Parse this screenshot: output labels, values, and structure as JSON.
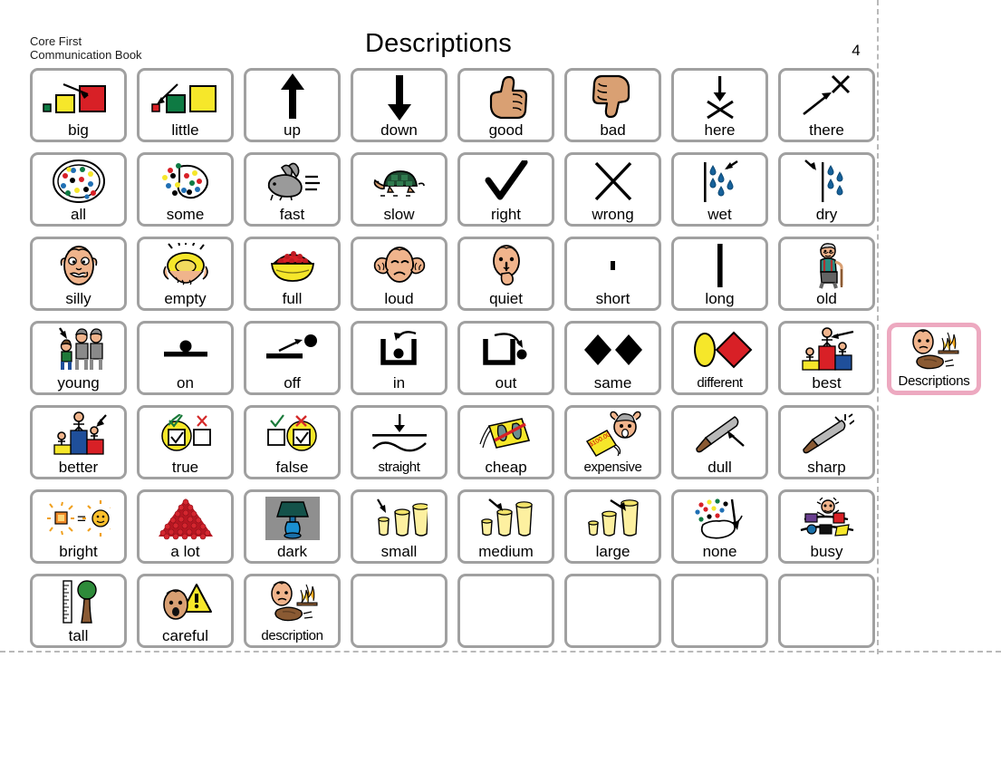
{
  "header": {
    "book_label": "Core First\nCommunication Book",
    "title": "Descriptions",
    "page_number": "4"
  },
  "side_tab": {
    "label": "Descriptions",
    "icon": "face-fire-rock-icon",
    "highlight_color": "#eda9c0"
  },
  "colors": {
    "cell_border": "#a0a0a0",
    "highlight": "#eda9c0",
    "dashed_guide": "#b9b9b9",
    "red": "#d82026",
    "yellow": "#f6e72a",
    "green": "#0e7a43",
    "skin": "#d9a073",
    "blue": "#1f6fb4",
    "gray": "#9a9a9a"
  },
  "grid": {
    "columns": 8,
    "rows": 7,
    "cells": [
      {
        "label": "big",
        "icon": "three-squares-big-icon"
      },
      {
        "label": "little",
        "icon": "three-squares-little-icon"
      },
      {
        "label": "up",
        "icon": "arrow-up-icon"
      },
      {
        "label": "down",
        "icon": "arrow-down-icon"
      },
      {
        "label": "good",
        "icon": "thumbs-up-icon"
      },
      {
        "label": "bad",
        "icon": "thumbs-down-icon"
      },
      {
        "label": "here",
        "icon": "arrow-to-x-icon"
      },
      {
        "label": "there",
        "icon": "arrow-toward-x-icon"
      },
      {
        "label": "all",
        "icon": "full-plate-dots-icon"
      },
      {
        "label": "some",
        "icon": "partial-plate-dots-icon"
      },
      {
        "label": "fast",
        "icon": "rabbit-icon"
      },
      {
        "label": "slow",
        "icon": "turtle-icon"
      },
      {
        "label": "right",
        "icon": "checkmark-icon"
      },
      {
        "label": "wrong",
        "icon": "x-mark-icon"
      },
      {
        "label": "wet",
        "icon": "raindrops-wet-icon"
      },
      {
        "label": "dry",
        "icon": "raindrops-dry-icon"
      },
      {
        "label": "silly",
        "icon": "silly-face-icon"
      },
      {
        "label": "empty",
        "icon": "empty-bowl-icon"
      },
      {
        "label": "full",
        "icon": "full-bowl-icon"
      },
      {
        "label": "loud",
        "icon": "covering-ears-icon"
      },
      {
        "label": "quiet",
        "icon": "shush-face-icon"
      },
      {
        "label": "short",
        "icon": "short-bar-icon"
      },
      {
        "label": "long",
        "icon": "long-bar-icon"
      },
      {
        "label": "old",
        "icon": "old-man-cane-icon"
      },
      {
        "label": "young",
        "icon": "child-with-adults-icon"
      },
      {
        "label": "on",
        "icon": "ball-on-line-icon"
      },
      {
        "label": "off",
        "icon": "ball-off-line-icon"
      },
      {
        "label": "in",
        "icon": "ball-into-box-icon"
      },
      {
        "label": "out",
        "icon": "ball-out-of-box-icon"
      },
      {
        "label": "same",
        "icon": "two-black-diamonds-icon"
      },
      {
        "label": "different",
        "icon": "oval-and-diamond-icon"
      },
      {
        "label": "best",
        "icon": "podium-first-icon"
      },
      {
        "label": "better",
        "icon": "podium-second-icon"
      },
      {
        "label": "true",
        "icon": "true-checkbox-icon"
      },
      {
        "label": "false",
        "icon": "false-checkbox-icon"
      },
      {
        "label": "straight",
        "icon": "straight-vs-wavy-icon"
      },
      {
        "label": "cheap",
        "icon": "cheap-price-tag-icon"
      },
      {
        "label": "expensive",
        "icon": "expensive-price-tag-icon"
      },
      {
        "label": "dull",
        "icon": "dull-knife-icon"
      },
      {
        "label": "sharp",
        "icon": "sharp-knife-icon"
      },
      {
        "label": "bright",
        "icon": "bright-sun-icon"
      },
      {
        "label": "a lot",
        "icon": "pile-of-berries-icon"
      },
      {
        "label": "dark",
        "icon": "lamp-dark-icon"
      },
      {
        "label": "small",
        "icon": "small-cup-icon"
      },
      {
        "label": "medium",
        "icon": "medium-cup-icon"
      },
      {
        "label": "large",
        "icon": "large-cup-icon"
      },
      {
        "label": "none",
        "icon": "empty-hand-icon"
      },
      {
        "label": "busy",
        "icon": "busy-juggler-icon"
      },
      {
        "label": "tall",
        "icon": "ruler-and-tree-icon"
      },
      {
        "label": "careful",
        "icon": "warning-face-icon"
      },
      {
        "label": "description",
        "icon": "face-fire-rock-icon"
      },
      {
        "label": "",
        "icon": ""
      },
      {
        "label": "",
        "icon": ""
      },
      {
        "label": "",
        "icon": ""
      },
      {
        "label": "",
        "icon": ""
      },
      {
        "label": "",
        "icon": ""
      }
    ]
  }
}
